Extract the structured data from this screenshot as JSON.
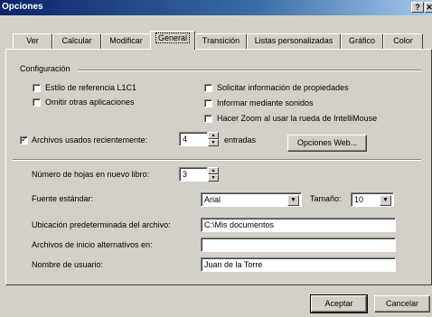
{
  "window": {
    "title": "Opciones",
    "help_label": "?",
    "close_label": "✕"
  },
  "tabs": [
    "Ver",
    "Calcular",
    "Modificar",
    "General",
    "Transición",
    "Listas personalizadas",
    "Gráfico",
    "Color"
  ],
  "config": {
    "group_label": "Configuración",
    "left": [
      {
        "label": "Estilo de referencia L1C1",
        "checked": false
      },
      {
        "label": "Omitir otras aplicaciones",
        "checked": false
      }
    ],
    "right": [
      {
        "label": "Solicitar información de propiedades",
        "checked": false
      },
      {
        "label": "Informar mediante sonidos",
        "checked": false
      },
      {
        "label": "Hacer Zoom al usar la rueda de IntelliMouse",
        "checked": false
      }
    ],
    "recent": {
      "label": "Archivos usados recientemente:",
      "checked": true,
      "value": "4",
      "suffix": "entradas"
    },
    "web_button": "Opciones Web..."
  },
  "sheets": {
    "label": "Número de hojas en nuevo libro:",
    "value": "3"
  },
  "font": {
    "label": "Fuente estándar:",
    "value": "Arial",
    "size_label": "Tamaño:",
    "size_value": "10"
  },
  "default_location": {
    "label": "Ubicación predeterminada del archivo:",
    "value": "C:\\Mis documentos"
  },
  "alt_startup": {
    "label": "Archivos de inicio alternativos en:",
    "value": ""
  },
  "username": {
    "label": "Nombre de usuario:",
    "value": "Juan de la Torre"
  },
  "buttons": {
    "ok": "Aceptar",
    "cancel": "Cancelar"
  }
}
